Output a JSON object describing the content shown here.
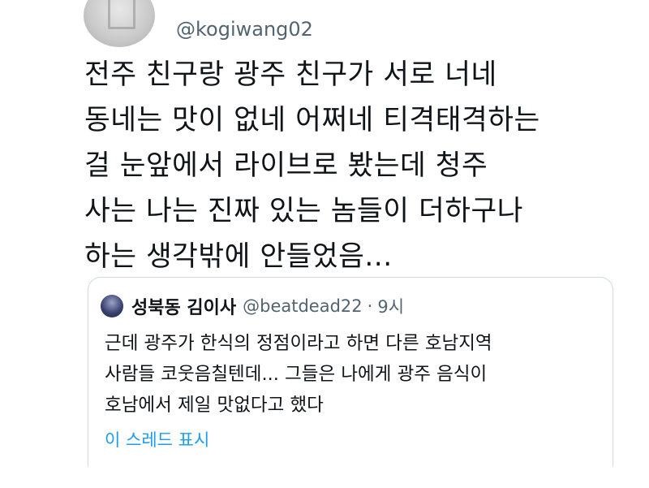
{
  "tweet": {
    "avatar_icon": "user-avatar",
    "handle": "@kogiwang02",
    "lines": [
      "전주 친구랑 광주 친구가 서로 너네",
      "동네는 맛이 없네 어쩌네 티격태격하는",
      "걸 눈앞에서 라이브로 봤는데 청주",
      "사는 나는 진짜 있는 놈들이 더하구나",
      "하는 생각밖에 안들었음..."
    ]
  },
  "quote": {
    "avatar_icon": "user-avatar",
    "name": "성북동 김이사",
    "handle": "@beatdead22",
    "separator": "·",
    "time": "9시",
    "lines": [
      "근데 광주가 한식의 정점이라고 하면 다른 호남지역",
      "사람들 코웃음칠텐데... 그들은 나에게 광주 음식이",
      "호남에서 제일 맛없다고 했다"
    ],
    "show_thread": "이 스레드 표시"
  },
  "colors": {
    "text": "#0f1419",
    "secondary": "#536471",
    "link": "#1d9bf0",
    "border": "#cfd9de"
  }
}
